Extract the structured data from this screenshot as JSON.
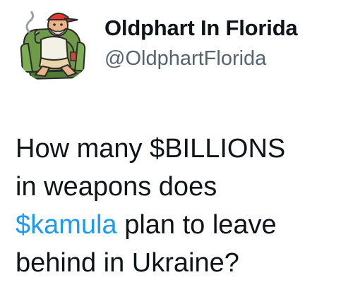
{
  "author": {
    "display_name": "Oldphart In Florida",
    "handle": "@OldphartFlorida",
    "avatar_icon": "cartoon-old-man-armchair-avatar"
  },
  "tweet": {
    "lines": [
      {
        "text": "How many $BILLIONS"
      },
      {
        "text": "in weapons does"
      },
      {
        "cashtag": "$kamula",
        "rest": " plan to leave"
      },
      {
        "text": "behind in Ukraine?"
      }
    ]
  },
  "colors": {
    "text": "#0f1419",
    "handle": "#536471",
    "link": "#1d9bf0",
    "background": "#ffffff"
  }
}
